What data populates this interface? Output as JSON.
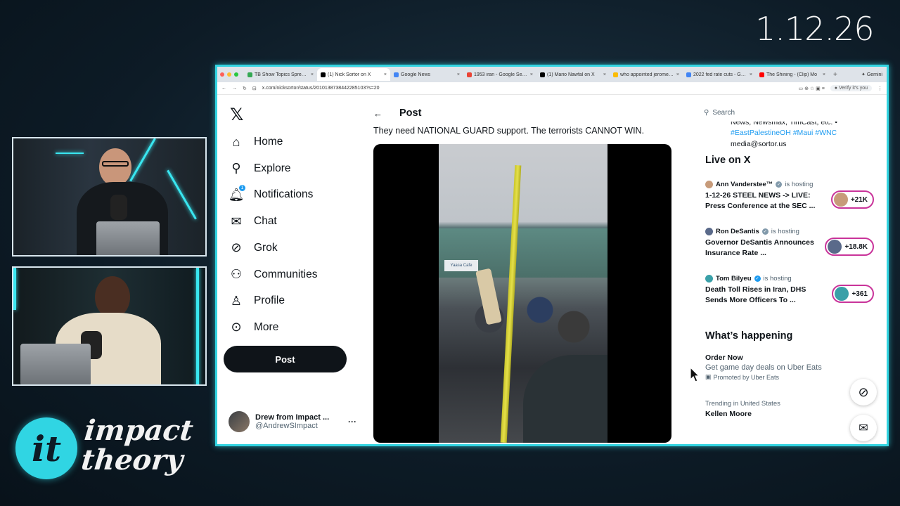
{
  "overlay": {
    "date": "1.12.26"
  },
  "logo": {
    "line1": "impact",
    "line2": "theory"
  },
  "browser": {
    "tabs": [
      {
        "title": "TB Show Topics Spreadsheet",
        "color": "#34a853",
        "active": false
      },
      {
        "title": "(1) Nick Sortor on X",
        "color": "#000000",
        "active": true
      },
      {
        "title": "Google News",
        "color": "#4285f4",
        "active": false
      },
      {
        "title": "1953 iran - Google Search",
        "color": "#ea4335",
        "active": false
      },
      {
        "title": "(1) Mario Nawfal on X",
        "color": "#000000",
        "active": false
      },
      {
        "title": "who appointed jerome powell",
        "color": "#fbbc05",
        "active": false
      },
      {
        "title": "2022 fed rate cuts - Google",
        "color": "#4285f4",
        "active": false
      },
      {
        "title": "The Shining - (Clip) Mo",
        "color": "#ff0000",
        "active": false
      }
    ],
    "gemini_label": "Gemini",
    "url": "x.com/nicksortor/status/2010138738442285103?s=20",
    "verify_label": "Verify it's you"
  },
  "nav": {
    "items": [
      {
        "label": "Home",
        "icon": "home-icon"
      },
      {
        "label": "Explore",
        "icon": "search-icon"
      },
      {
        "label": "Notifications",
        "icon": "bell-icon",
        "badge": "1"
      },
      {
        "label": "Chat",
        "icon": "mail-icon"
      },
      {
        "label": "Grok",
        "icon": "grok-icon"
      },
      {
        "label": "Communities",
        "icon": "communities-icon"
      },
      {
        "label": "Profile",
        "icon": "person-icon"
      },
      {
        "label": "More",
        "icon": "more-circle-icon"
      }
    ],
    "post_button": "Post",
    "account": {
      "name": "Drew from Impact ...",
      "handle": "@AndrewSImpact"
    }
  },
  "post": {
    "header": "Post",
    "text": "They need NATIONAL GUARD support. The terrorists CANNOT WIN.",
    "store_sign": "Yaasa Cafe"
  },
  "sidebar": {
    "search_placeholder": "Search",
    "bio_cut": "News, Newsmax, TimCast, etc. •",
    "bio_tags": "#EastPalestineOH #Maui #WNC",
    "bio_email": "media@sortor.us",
    "live_title": "Live on X",
    "live_items": [
      {
        "host": "Ann Vanderstee™",
        "hosting": "is hosting",
        "title": "1-12-26 STEEL NEWS -> LIVE: Press Conference at the SEC ...",
        "count": "+21K",
        "verified": "gray"
      },
      {
        "host": "Ron DeSantis",
        "hosting": "is hosting",
        "title": "Governor DeSantis Announces Insurance Rate ...",
        "count": "+18.8K",
        "verified": "gray"
      },
      {
        "host": "Tom Bilyeu",
        "hosting": "is hosting",
        "title": "Death Toll Rises in Iran, DHS Sends More Officers To ...",
        "count": "+361",
        "verified": "blue"
      }
    ],
    "happening_title": "What’s happening",
    "promo": {
      "title": "Order Now",
      "desc": "Get game day deals on Uber Eats",
      "label": "Promoted by Uber Eats"
    },
    "trend": {
      "context": "Trending in United States",
      "title": "Kellen Moore"
    }
  }
}
